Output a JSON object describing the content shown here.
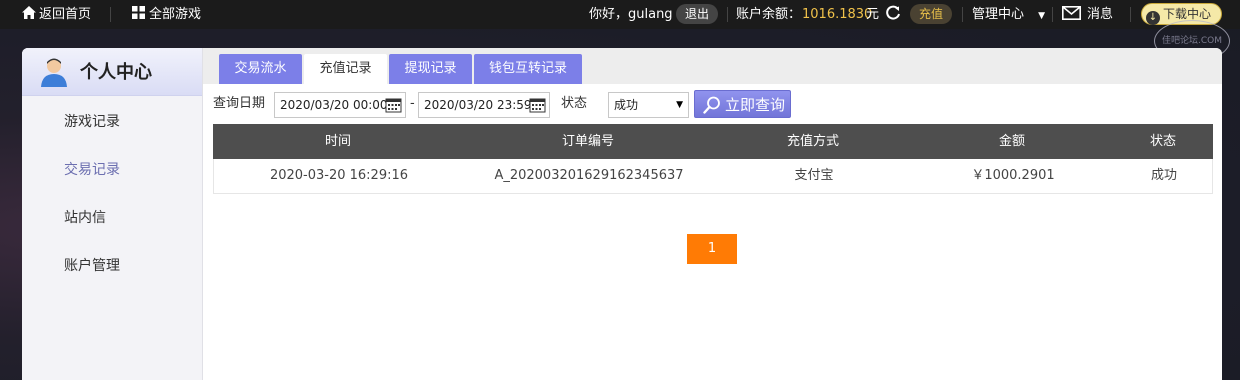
{
  "topbar": {
    "home_label": "返回首页",
    "games_label": "全部游戏",
    "greeting": "你好，gulang",
    "logout_label": "退出",
    "balance_label": "账户余额：",
    "balance_value": "1016.1830",
    "balance_unit": "元",
    "recharge_label": "充值",
    "manage_label": "管理中心",
    "message_label": "消息",
    "download_label": "下载中心"
  },
  "sidebar": {
    "title": "个人中心",
    "items": [
      {
        "label": "游戏记录"
      },
      {
        "label": "交易记录"
      },
      {
        "label": "站内信"
      },
      {
        "label": "账户管理"
      }
    ],
    "active_index": 1
  },
  "tabs": [
    {
      "label": "交易流水"
    },
    {
      "label": "充值记录"
    },
    {
      "label": "提现记录"
    },
    {
      "label": "钱包互转记录"
    }
  ],
  "active_tab": 1,
  "query": {
    "date_label": "查询日期",
    "start": "2020/03/20 00:00",
    "dash": "-",
    "end": "2020/03/20 23:59",
    "status_label": "状态",
    "status_value": "成功",
    "button_label": "立即查询"
  },
  "table": {
    "columns": [
      "时间",
      "订单编号",
      "充值方式",
      "金额",
      "状态"
    ],
    "rows": [
      [
        "2020-03-20 16:29:16",
        "A_20200320162916234563​7",
        "支付宝",
        "￥1000.2901",
        "成功"
      ]
    ]
  },
  "pager": {
    "current": "1"
  },
  "watermark": {
    "text": "佳吧论坛.COM"
  },
  "colors": {
    "accent": "#7c7fe8",
    "pager": "#ff7b05",
    "gold": "#f0c24a"
  }
}
